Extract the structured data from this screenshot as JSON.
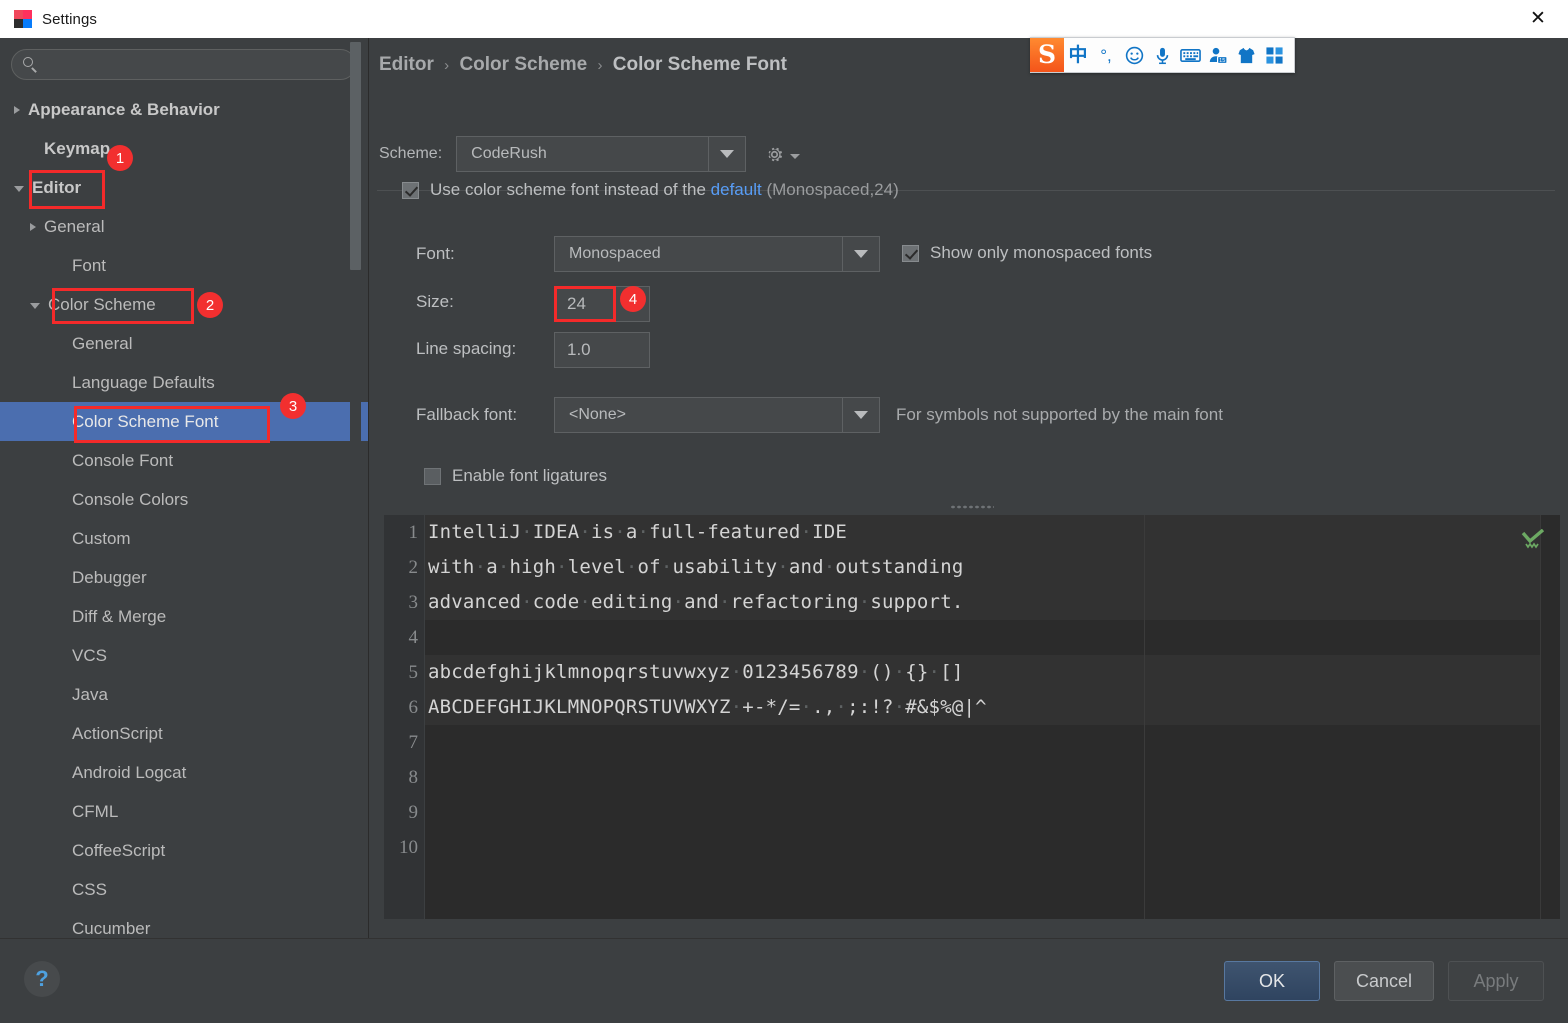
{
  "window": {
    "title": "Settings",
    "app_icon": "intellij-idea-icon",
    "close_label": "✕"
  },
  "sidebar": {
    "search": {
      "value": "",
      "placeholder": "",
      "icon": "search-icon"
    },
    "items": [
      {
        "label": "Appearance & Behavior",
        "indent": 0,
        "arrow": "right",
        "bold": true,
        "selected": false
      },
      {
        "label": "Keymap",
        "indent": 1,
        "arrow": "none",
        "bold": true,
        "selected": false
      },
      {
        "label": "Editor",
        "indent": 0,
        "arrow": "down",
        "bold": true,
        "selected": false
      },
      {
        "label": "General",
        "indent": 1,
        "arrow": "right",
        "bold": false,
        "selected": false
      },
      {
        "label": "Font",
        "indent": 2,
        "arrow": "none",
        "bold": false,
        "selected": false
      },
      {
        "label": "Color Scheme",
        "indent": 1,
        "arrow": "down",
        "bold": false,
        "selected": false
      },
      {
        "label": "General",
        "indent": 3,
        "arrow": "none",
        "bold": false,
        "selected": false
      },
      {
        "label": "Language Defaults",
        "indent": 3,
        "arrow": "none",
        "bold": false,
        "selected": false
      },
      {
        "label": "Color Scheme Font",
        "indent": 3,
        "arrow": "none",
        "bold": false,
        "selected": true
      },
      {
        "label": "Console Font",
        "indent": 3,
        "arrow": "none",
        "bold": false,
        "selected": false
      },
      {
        "label": "Console Colors",
        "indent": 3,
        "arrow": "none",
        "bold": false,
        "selected": false
      },
      {
        "label": "Custom",
        "indent": 3,
        "arrow": "none",
        "bold": false,
        "selected": false
      },
      {
        "label": "Debugger",
        "indent": 3,
        "arrow": "none",
        "bold": false,
        "selected": false
      },
      {
        "label": "Diff & Merge",
        "indent": 3,
        "arrow": "none",
        "bold": false,
        "selected": false
      },
      {
        "label": "VCS",
        "indent": 3,
        "arrow": "none",
        "bold": false,
        "selected": false
      },
      {
        "label": "Java",
        "indent": 3,
        "arrow": "none",
        "bold": false,
        "selected": false
      },
      {
        "label": "ActionScript",
        "indent": 3,
        "arrow": "none",
        "bold": false,
        "selected": false
      },
      {
        "label": "Android Logcat",
        "indent": 3,
        "arrow": "none",
        "bold": false,
        "selected": false
      },
      {
        "label": "CFML",
        "indent": 3,
        "arrow": "none",
        "bold": false,
        "selected": false
      },
      {
        "label": "CoffeeScript",
        "indent": 3,
        "arrow": "none",
        "bold": false,
        "selected": false
      },
      {
        "label": "CSS",
        "indent": 3,
        "arrow": "none",
        "bold": false,
        "selected": false
      },
      {
        "label": "Cucumber",
        "indent": 3,
        "arrow": "none",
        "bold": false,
        "selected": false
      }
    ]
  },
  "breadcrumb": {
    "part1": "Editor",
    "part2": "Color Scheme",
    "part3": "Color Scheme Font",
    "separator": "›"
  },
  "scheme": {
    "label": "Scheme:",
    "value": "CodeRush",
    "gear_icon": "gear-icon"
  },
  "form": {
    "use_scheme_font": {
      "checked": true,
      "text_before": "Use color scheme font instead of the",
      "link": "default",
      "text_after": "(Monospaced,24)"
    },
    "font": {
      "label": "Font:",
      "value": "Monospaced"
    },
    "show_only_monospaced": {
      "label": "Show only monospaced fonts",
      "checked": true
    },
    "size": {
      "label": "Size:",
      "value": "24"
    },
    "line_spacing": {
      "label": "Line spacing:",
      "value": "1.0"
    },
    "fallback_font": {
      "label": "Fallback font:",
      "value": "<None>",
      "hint": "For symbols not supported by the main font"
    },
    "ligatures": {
      "label": "Enable font ligatures",
      "checked": false
    }
  },
  "annotations": [
    {
      "id": "1",
      "target": "editor-tree-item"
    },
    {
      "id": "2",
      "target": "color-scheme-tree-item"
    },
    {
      "id": "3",
      "target": "color-scheme-font-tree-item"
    },
    {
      "id": "4",
      "target": "size-field"
    }
  ],
  "preview": {
    "line_numbers": [
      "1",
      "2",
      "3",
      "4",
      "5",
      "6",
      "7",
      "8",
      "9",
      "10"
    ],
    "lines": [
      "IntelliJ·IDEA·is·a·full-featured·IDE",
      "with·a·high·level·of·usability·and·outstanding",
      "advanced·code·editing·and·refactoring·support.",
      "",
      "abcdefghijklmnopqrstuvwxyz·0123456789·()·{}·[]",
      "ABCDEFGHIJKLMNOPQRSTUVWXYZ·+-*/=·.,·;:!?·#&$%@|^"
    ],
    "inspection_icon": "green-check-icon"
  },
  "footer": {
    "help": "?",
    "ok": "OK",
    "cancel": "Cancel",
    "apply": "Apply"
  },
  "ime_toolbar": {
    "logo": "S",
    "items": [
      {
        "icon": "chinese-mode-icon",
        "glyph": "中"
      },
      {
        "icon": "punctuation-icon",
        "glyph": "°,"
      },
      {
        "icon": "emoji-icon",
        "glyph": "☺"
      },
      {
        "icon": "microphone-icon",
        "glyph": ""
      },
      {
        "icon": "soft-keyboard-icon",
        "glyph": ""
      },
      {
        "icon": "user-account-icon",
        "glyph": ""
      },
      {
        "icon": "skin-shirt-icon",
        "glyph": ""
      },
      {
        "icon": "toolbox-grid-icon",
        "glyph": ""
      }
    ]
  },
  "colors": {
    "background": "#3c3f41",
    "selection": "#4b6eaf",
    "annotation_red": "#f42a2a",
    "link_blue": "#589df6",
    "editor_bg": "#2b2b2b",
    "ime_blue": "#1175c6"
  }
}
